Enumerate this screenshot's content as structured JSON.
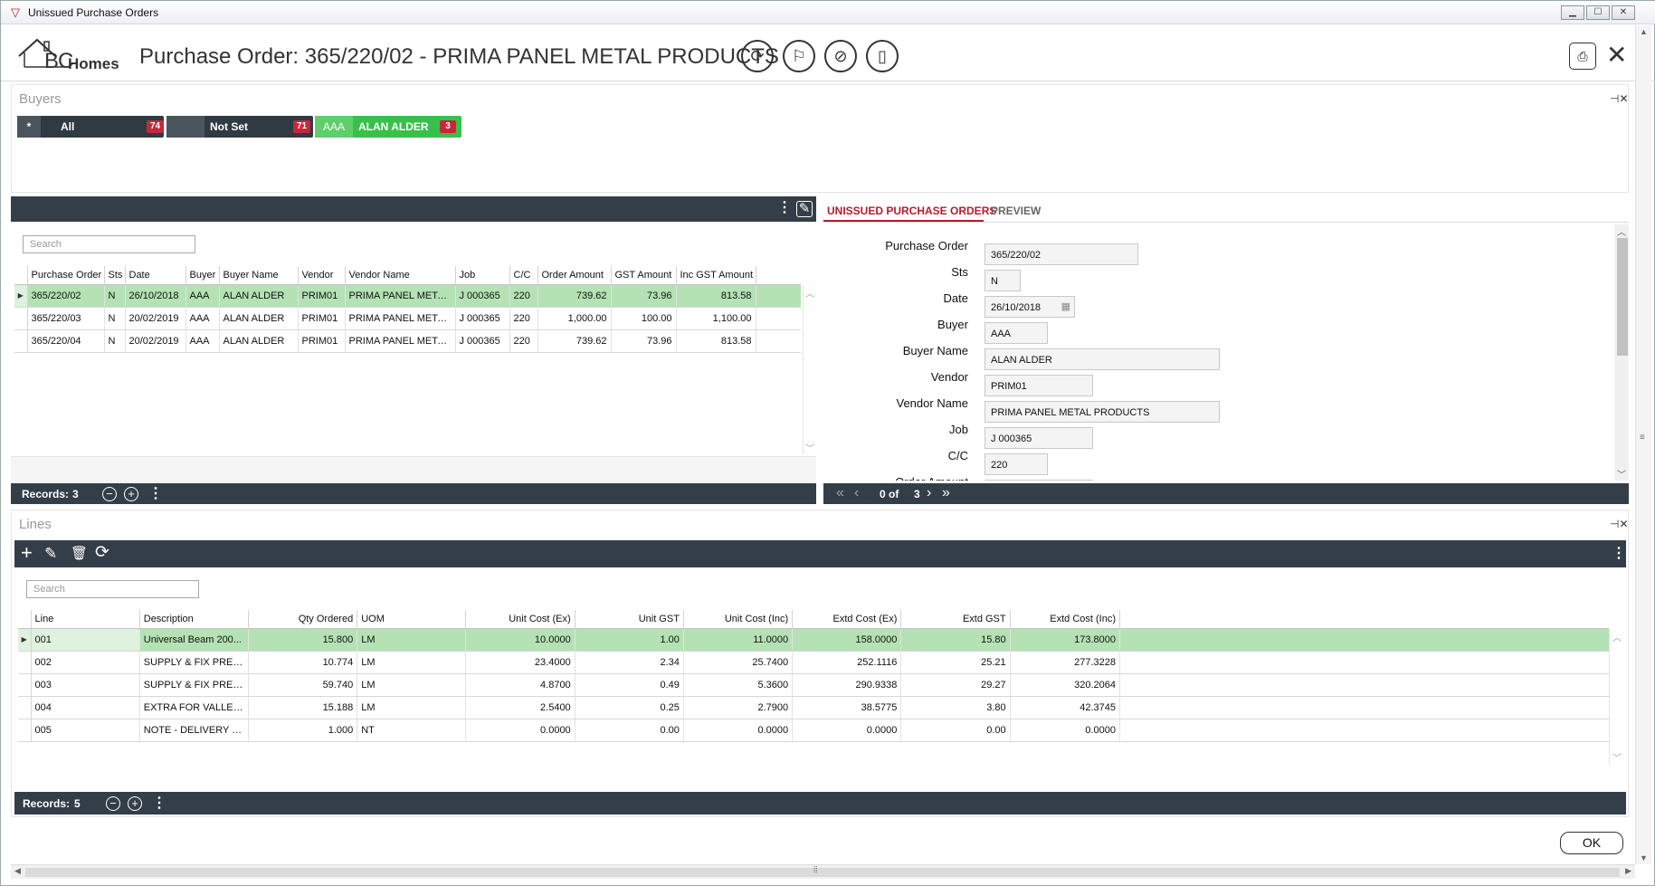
{
  "window": {
    "title": "Unissued Purchase Orders",
    "minimize": "▁",
    "maximize": "☐",
    "close": "✕"
  },
  "header": {
    "logo_bc": "BC",
    "logo_homes": "Homes",
    "title": "Purchase Order: 365/220/02 - PRIMA PANEL METAL PRODUCTS",
    "close": "✕"
  },
  "buyers": {
    "label": "Buyers",
    "pin": "⊣✕",
    "chips": [
      {
        "code": "*",
        "name": "All",
        "count": "74"
      },
      {
        "code": "",
        "name": "Not Set",
        "count": "71"
      },
      {
        "code": "AAA",
        "name": "ALAN ALDER",
        "count": "3"
      }
    ]
  },
  "orders": {
    "search_placeholder": "Search",
    "columns": [
      "Purchase Order",
      "Sts",
      "Date",
      "Buyer",
      "Buyer Name",
      "Vendor",
      "Vendor Name",
      "Job",
      "C/C",
      "Order Amount",
      "GST Amount",
      "Inc GST Amount"
    ],
    "rows": [
      [
        "365/220/02",
        "N",
        "26/10/2018",
        "AAA",
        "ALAN ALDER",
        "PRIM01",
        "PRIMA PANEL METAL...",
        "J 000365",
        "220",
        "739.62",
        "73.96",
        "813.58"
      ],
      [
        "365/220/03",
        "N",
        "20/02/2019",
        "AAA",
        "ALAN ALDER",
        "PRIM01",
        "PRIMA PANEL METAL...",
        "J 000365",
        "220",
        "1,000.00",
        "100.00",
        "1,100.00"
      ],
      [
        "365/220/04",
        "N",
        "20/02/2019",
        "AAA",
        "ALAN ALDER",
        "PRIM01",
        "PRIMA PANEL METAL...",
        "J 000365",
        "220",
        "739.62",
        "73.96",
        "813.58"
      ]
    ],
    "records_label": "Records:",
    "records_count": "3"
  },
  "detail": {
    "tabs": [
      "UNISSUED PURCHASE ORDERS",
      "PREVIEW"
    ],
    "fields": [
      {
        "label": "Purchase Order",
        "value": "365/220/02"
      },
      {
        "label": "Sts",
        "value": "N"
      },
      {
        "label": "Date",
        "value": "26/10/2018"
      },
      {
        "label": "Buyer",
        "value": "AAA"
      },
      {
        "label": "Buyer Name",
        "value": "ALAN ALDER"
      },
      {
        "label": "Vendor",
        "value": "PRIM01"
      },
      {
        "label": "Vendor Name",
        "value": "PRIMA PANEL METAL PRODUCTS"
      },
      {
        "label": "Job",
        "value": "J 000365"
      },
      {
        "label": "C/C",
        "value": "220"
      },
      {
        "label": "Order Amount",
        "value": ""
      }
    ],
    "nav_position": "0 of",
    "nav_total": "3"
  },
  "lines": {
    "label": "Lines",
    "pin": "⊣✕",
    "search_placeholder": "Search",
    "columns": [
      "Line",
      "Description",
      "Qty Ordered",
      "UOM",
      "Unit Cost (Ex)",
      "Unit GST",
      "Unit Cost (Inc)",
      "Extd Cost (Ex)",
      "Extd GST",
      "Extd Cost (Inc)"
    ],
    "rows": [
      [
        "001",
        "Universal Beam 200...",
        "15.800",
        "LM",
        "10.0000",
        "1.00",
        "11.0000",
        "158.0000",
        "15.80",
        "173.8000"
      ],
      [
        "002",
        "SUPPLY & FIX PRE-P...",
        "10.774",
        "LM",
        "23.4000",
        "2.34",
        "25.7400",
        "252.1116",
        "25.21",
        "277.3228"
      ],
      [
        "003",
        "SUPPLY & FIX PRE-P...",
        "59.740",
        "LM",
        "4.8700",
        "0.49",
        "5.3600",
        "290.9338",
        "29.27",
        "320.2064"
      ],
      [
        "004",
        "EXTRA FOR VALLEY I...",
        "15.188",
        "LM",
        "2.5400",
        "0.25",
        "2.7900",
        "38.5775",
        "3.80",
        "42.3745"
      ],
      [
        "005",
        "NOTE - DELIVERY DA...",
        "1.000",
        "NT",
        "0.0000",
        "0.00",
        "0.0000",
        "0.0000",
        "0.00",
        "0.0000"
      ]
    ],
    "records_label": "Records:",
    "records_count": "5"
  },
  "ok_label": "OK",
  "colors": {
    "dark_bar": "#333e48",
    "selected_row": "#b4e2b4",
    "accent_red": "#c6283a",
    "chip_green": "#3ac04a"
  }
}
